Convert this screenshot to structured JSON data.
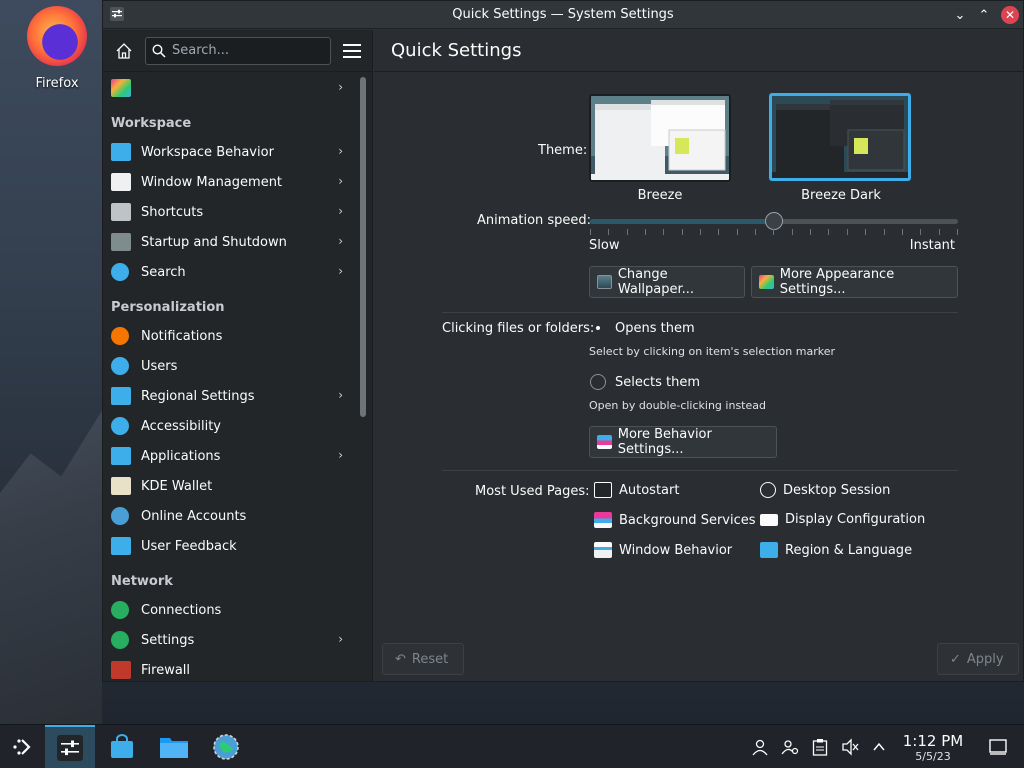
{
  "desktop": {
    "icon_label": "Firefox"
  },
  "window": {
    "title": "Quick Settings — System Settings",
    "minimize_glyph": "⌄",
    "maximize_glyph": "⌃",
    "close_glyph": "✕"
  },
  "sidebar": {
    "search_placeholder": "Search...",
    "items_top": [
      {
        "label": "",
        "icon": "appearance-icon",
        "chevron": "›"
      }
    ],
    "sections": [
      {
        "title": "Workspace",
        "items": [
          {
            "label": "Workspace Behavior",
            "icon": "workspace-behavior-icon",
            "color": "#3daee9",
            "chevron": "›"
          },
          {
            "label": "Window Management",
            "icon": "window-management-icon",
            "color": "#eff0f1",
            "chevron": "›"
          },
          {
            "label": "Shortcuts",
            "icon": "keyboard-icon",
            "color": "#bdc3c7",
            "chevron": "›"
          },
          {
            "label": "Startup and Shutdown",
            "icon": "startup-icon",
            "color": "#7f8c8d",
            "chevron": "›"
          },
          {
            "label": "Search",
            "icon": "search-icon",
            "color": "#3daee9",
            "chevron": "›"
          }
        ]
      },
      {
        "title": "Personalization",
        "items": [
          {
            "label": "Notifications",
            "icon": "bell-icon",
            "color": "#f67400",
            "chevron": ""
          },
          {
            "label": "Users",
            "icon": "users-icon",
            "color": "#3daee9",
            "chevron": ""
          },
          {
            "label": "Regional Settings",
            "icon": "regional-settings-icon",
            "color": "#3daee9",
            "chevron": "›"
          },
          {
            "label": "Accessibility",
            "icon": "accessibility-icon",
            "color": "#3daee9",
            "chevron": ""
          },
          {
            "label": "Applications",
            "icon": "applications-icon",
            "color": "#3daee9",
            "chevron": "›"
          },
          {
            "label": "KDE Wallet",
            "icon": "wallet-icon",
            "color": "#e9e0c8",
            "chevron": ""
          },
          {
            "label": "Online Accounts",
            "icon": "online-accounts-icon",
            "color": "#4a9ed6",
            "chevron": ""
          },
          {
            "label": "User Feedback",
            "icon": "feedback-icon",
            "color": "#3daee9",
            "chevron": ""
          }
        ]
      },
      {
        "title": "Network",
        "items": [
          {
            "label": "Connections",
            "icon": "globe-icon",
            "color": "#27ae60",
            "chevron": ""
          },
          {
            "label": "Settings",
            "icon": "globe-settings-icon",
            "color": "#27ae60",
            "chevron": "›"
          },
          {
            "label": "Firewall",
            "icon": "firewall-icon",
            "color": "#c0392b",
            "chevron": ""
          }
        ]
      }
    ]
  },
  "main": {
    "header": "Quick Settings",
    "theme_label": "Theme:",
    "themes": [
      {
        "name": "Breeze",
        "selected": false
      },
      {
        "name": "Breeze Dark",
        "selected": true
      }
    ],
    "animation": {
      "label": "Animation speed:",
      "min_label": "Slow",
      "max_label": "Instant",
      "value": 0.5
    },
    "buttons": {
      "change_wallpaper": "Change Wallpaper...",
      "more_appearance": "More Appearance Settings...",
      "more_behavior": "More Behavior Settings..."
    },
    "clicking": {
      "label": "Clicking files or folders:",
      "options": [
        {
          "label": "Opens them",
          "hint": "Select by clicking on item's selection marker",
          "checked": true
        },
        {
          "label": "Selects them",
          "hint": "Open by double-clicking instead",
          "checked": false
        }
      ]
    },
    "most_used": {
      "label": "Most Used Pages:",
      "items": [
        {
          "label": "Autostart",
          "icon": "autostart-icon"
        },
        {
          "label": "Desktop Session",
          "icon": "desktop-session-icon"
        },
        {
          "label": "Background Services",
          "icon": "background-services-icon"
        },
        {
          "label": "Display Configuration",
          "icon": "display-icon"
        },
        {
          "label": "Window Behavior",
          "icon": "window-behavior-icon"
        },
        {
          "label": "Region & Language",
          "icon": "region-language-icon"
        }
      ]
    },
    "footer": {
      "reset": "Reset",
      "apply": "Apply"
    }
  },
  "taskbar": {
    "time": "1:12 PM",
    "date": "5/5/23"
  },
  "colors": {
    "accent": "#3daee9",
    "window_bg": "#2a2e32",
    "sidebar_bg": "#232629"
  }
}
